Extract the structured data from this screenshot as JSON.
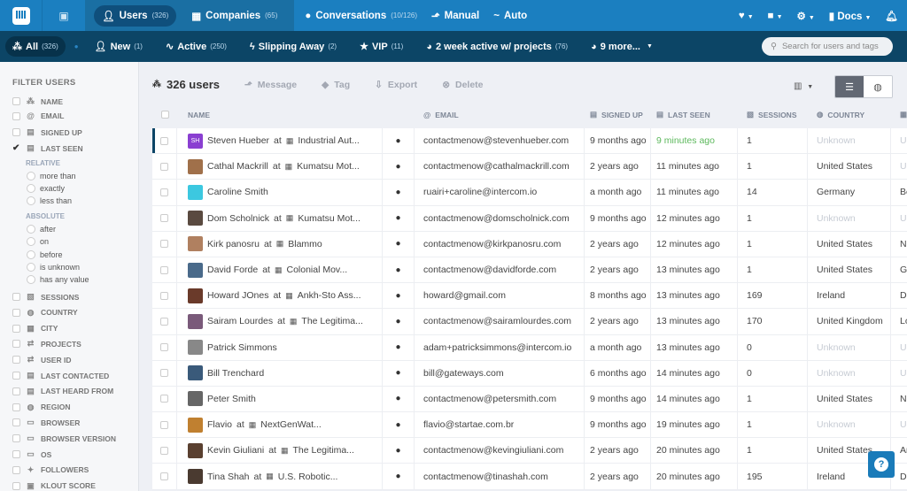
{
  "topnav": {
    "users": "Users",
    "users_count": "(326)",
    "companies": "Companies",
    "companies_count": "(65)",
    "conversations": "Conversations",
    "conversations_count": "(10/126)",
    "manual": "Manual",
    "auto": "Auto",
    "docs": "Docs"
  },
  "segments": [
    {
      "label": "All",
      "count": "(326)"
    },
    {
      "label": "New",
      "count": "(1)"
    },
    {
      "label": "Active",
      "count": "(250)"
    },
    {
      "label": "Slipping Away",
      "count": "(2)"
    },
    {
      "label": "VIP",
      "count": "(11)"
    },
    {
      "label": "2 week active w/ projects",
      "count": "(76)"
    },
    {
      "label": "9 more...",
      "count": ""
    }
  ],
  "search": {
    "placeholder": "Search for users and tags"
  },
  "sidebar": {
    "title": "FILTER USERS",
    "relative": "RELATIVE",
    "absolute": "ABSOLUTE",
    "relative_options": [
      "more than",
      "exactly",
      "less than"
    ],
    "absolute_options": [
      "after",
      "on",
      "before",
      "is unknown",
      "has any value"
    ],
    "filters_top": [
      {
        "label": "NAME",
        "icon": "people-icon"
      },
      {
        "label": "EMAIL",
        "icon": "at-icon"
      },
      {
        "label": "SIGNED UP",
        "icon": "calendar-icon"
      },
      {
        "label": "LAST SEEN",
        "icon": "calendar-icon",
        "checked": true
      }
    ],
    "filters_bottom": [
      {
        "label": "SESSIONS",
        "icon": "chart-icon"
      },
      {
        "label": "COUNTRY",
        "icon": "globe-icon"
      },
      {
        "label": "CITY",
        "icon": "building-icon"
      },
      {
        "label": "PROJECTS",
        "icon": "arrows-icon"
      },
      {
        "label": "USER ID",
        "icon": "arrows-icon"
      },
      {
        "label": "LAST CONTACTED",
        "icon": "calendar-icon"
      },
      {
        "label": "LAST HEARD FROM",
        "icon": "calendar-icon"
      },
      {
        "label": "REGION",
        "icon": "globe-icon"
      },
      {
        "label": "BROWSER",
        "icon": "laptop-icon"
      },
      {
        "label": "BROWSER VERSION",
        "icon": "laptop-icon"
      },
      {
        "label": "OS",
        "icon": "laptop-icon"
      },
      {
        "label": "FOLLOWERS",
        "icon": "twitter-icon"
      },
      {
        "label": "KLOUT SCORE",
        "icon": "card-icon"
      }
    ]
  },
  "toolbar": {
    "count": "326 users",
    "message": "Message",
    "tag": "Tag",
    "export": "Export",
    "delete": "Delete"
  },
  "columns": {
    "name": "NAME",
    "email": "EMAIL",
    "signed_up": "SIGNED UP",
    "last_seen": "LAST SEEN",
    "sessions": "SESSIONS",
    "country": "COUNTRY"
  },
  "at": "at",
  "rows": [
    {
      "name": "Steven Hueber",
      "initials": "SH",
      "company": "Industrial Aut...",
      "email": "contactmenow@stevenhueber.com",
      "signed_up": "9 months ago",
      "last_seen": "9 minutes ago",
      "sessions": "1",
      "country": "Unknown",
      "city": "U"
    },
    {
      "name": "Cathal Mackrill",
      "company": "Kumatsu Mot...",
      "email": "contactmenow@cathalmackrill.com",
      "signed_up": "2 years ago",
      "last_seen": "11 minutes ago",
      "sessions": "1",
      "country": "United States",
      "city": "U"
    },
    {
      "name": "Caroline Smith",
      "company": "",
      "email": "ruairi+caroline@intercom.io",
      "signed_up": "a month ago",
      "last_seen": "11 minutes ago",
      "sessions": "14",
      "country": "Germany",
      "city": "Be"
    },
    {
      "name": "Dom Scholnick",
      "company": "Kumatsu Mot...",
      "email": "contactmenow@domscholnick.com",
      "signed_up": "9 months ago",
      "last_seen": "12 minutes ago",
      "sessions": "1",
      "country": "Unknown",
      "city": "U"
    },
    {
      "name": "Kirk panosru",
      "company": "Blammo",
      "email": "contactmenow@kirkpanosru.com",
      "signed_up": "2 years ago",
      "last_seen": "12 minutes ago",
      "sessions": "1",
      "country": "United States",
      "city": "N"
    },
    {
      "name": "David Forde",
      "company": "Colonial Mov...",
      "email": "contactmenow@davidforde.com",
      "signed_up": "2 years ago",
      "last_seen": "13 minutes ago",
      "sessions": "1",
      "country": "United States",
      "city": "G"
    },
    {
      "name": "Howard JOnes",
      "company": "Ankh-Sto Ass...",
      "email": "howard@gmail.com",
      "signed_up": "8 months ago",
      "last_seen": "13 minutes ago",
      "sessions": "169",
      "country": "Ireland",
      "city": "D"
    },
    {
      "name": "Sairam Lourdes",
      "company": "The Legitima...",
      "email": "contactmenow@sairamlourdes.com",
      "signed_up": "2 years ago",
      "last_seen": "13 minutes ago",
      "sessions": "170",
      "country": "United Kingdom",
      "city": "Lo"
    },
    {
      "name": "Patrick Simmons",
      "company": "",
      "email": "adam+patricksimmons@intercom.io",
      "signed_up": "a month ago",
      "last_seen": "13 minutes ago",
      "sessions": "0",
      "country": "Unknown",
      "city": "U"
    },
    {
      "name": "Bill Trenchard",
      "company": "",
      "email": "bill@gateways.com",
      "signed_up": "6 months ago",
      "last_seen": "14 minutes ago",
      "sessions": "0",
      "country": "Unknown",
      "city": "U"
    },
    {
      "name": "Peter Smith",
      "company": "",
      "email": "contactmenow@petersmith.com",
      "signed_up": "9 months ago",
      "last_seen": "14 minutes ago",
      "sessions": "1",
      "country": "United States",
      "city": "N"
    },
    {
      "name": "Flavio",
      "company": "NextGenWat...",
      "email": "flavio@startae.com.br",
      "signed_up": "9 months ago",
      "last_seen": "19 minutes ago",
      "sessions": "1",
      "country": "Unknown",
      "city": "U"
    },
    {
      "name": "Kevin Giuliani",
      "company": "The Legitima...",
      "email": "contactmenow@kevingiuliani.com",
      "signed_up": "2 years ago",
      "last_seen": "20 minutes ago",
      "sessions": "1",
      "country": "United States",
      "city": "Ar"
    },
    {
      "name": "Tina Shah",
      "company": "U.S. Robotic...",
      "email": "contactmenow@tinashah.com",
      "signed_up": "2 years ago",
      "last_seen": "20 minutes ago",
      "sessions": "195",
      "country": "Ireland",
      "city": "D"
    }
  ],
  "colors": {
    "topbar": "#1b7fc0",
    "segbar": "#0c4566",
    "recent": "#5cb85c",
    "unknown": "#c6cbd3"
  },
  "help": "?"
}
